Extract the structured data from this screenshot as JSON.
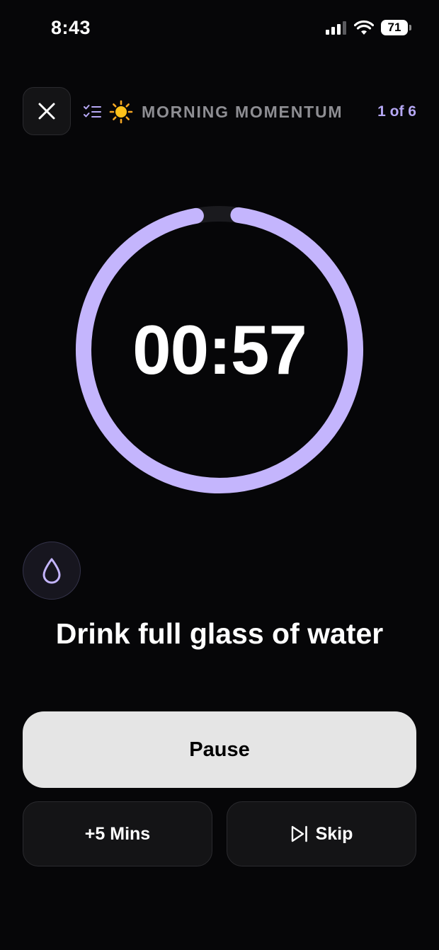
{
  "status_bar": {
    "time": "8:43",
    "battery": "71"
  },
  "header": {
    "close_icon": "close-icon",
    "checklist_icon": "checklist-icon",
    "sun_icon": "sun-icon",
    "routine_title": "MORNING MOMENTUM",
    "progress": "1 of 6"
  },
  "timer": {
    "display": "00:57",
    "ring_fraction_remaining": 0.95,
    "accent_color": "#c4b5fd"
  },
  "task": {
    "icon": "water-drop-icon",
    "title": "Drink full glass of water"
  },
  "controls": {
    "pause_label": "Pause",
    "add_time_label": "+5 Mins",
    "skip_label": "Skip",
    "skip_icon": "skip-forward-icon"
  }
}
